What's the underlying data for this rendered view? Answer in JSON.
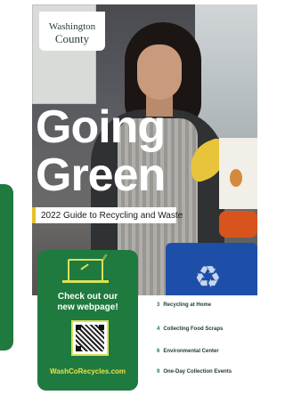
{
  "logo": {
    "line1": "Washington",
    "line2": "County"
  },
  "title": {
    "line1": "Going",
    "line2": "Green"
  },
  "subtitle": "2022 Guide to Recycling and Waste",
  "card": {
    "line1": "Check out our",
    "line2": "new webpage!",
    "url": "WashCoRecycles.com"
  },
  "toc": [
    {
      "page": "3",
      "title": "Recycling at Home"
    },
    {
      "page": "4",
      "title": "Collecting Food Scraps"
    },
    {
      "page": "6",
      "title": "Environmental Center"
    },
    {
      "page": "9",
      "title": "One-Day Collection Events"
    }
  ],
  "colors": {
    "brand_green": "#1f7a3f",
    "accent_yellow": "#e8c02e",
    "url_yellow": "#e8e24a"
  },
  "icons": [
    "laptop-icon",
    "qr-code",
    "recycle-icon"
  ]
}
